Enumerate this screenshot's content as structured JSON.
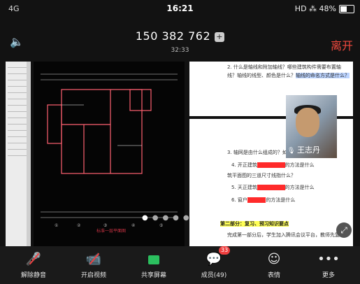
{
  "status": {
    "signal": "4G",
    "time": "16:21",
    "right": "HD",
    "battery": "48%"
  },
  "header": {
    "meeting_id": "150 382 762",
    "duration": "32:33",
    "leave_label": "离开"
  },
  "share": {
    "cad_caption": "标准一层平面图",
    "doc_page1": {
      "line1": "2. 什么是轴线和附加轴线？哪些建筑构件需要布置轴",
      "line2a": "线？轴线的线型、颜色是什么？",
      "line2b": "轴线的命名方式是什么？"
    },
    "doc_page2": {
      "q3": "3. 轴网是由什么组成的？如何理解坐标和进深？",
      "q4a": "4. 开正建筑",
      "q4b": "的方法是什么",
      "q4c": "筑平面图的三道尺寸线指什么？",
      "q5a": "5. 天正建筑",
      "q5b": "的方法是什么",
      "q6a": "6. 窗户",
      "q6b": "的方法是什么",
      "part2": "第二部分：复习、预习知识要点",
      "note": "完成第一部分后，学生加入腾讯会议平台，教师先复习"
    },
    "pip_name": "王志丹"
  },
  "toolbar": {
    "unmute": "解除静音",
    "video": "开启视频",
    "share": "共享屏幕",
    "members": "成员(49)",
    "members_badge": "33",
    "reactions": "表情",
    "more": "更多"
  },
  "colors": {
    "leave": "#f2493e",
    "share_icon": "#2bbf5e",
    "badge": "#f04040"
  },
  "icons": [
    "speaker-icon",
    "shield-icon",
    "mic-muted-icon",
    "video-off-icon",
    "share-screen-icon",
    "members-icon",
    "emoji-icon",
    "more-icon",
    "fullscreen-icon"
  ]
}
